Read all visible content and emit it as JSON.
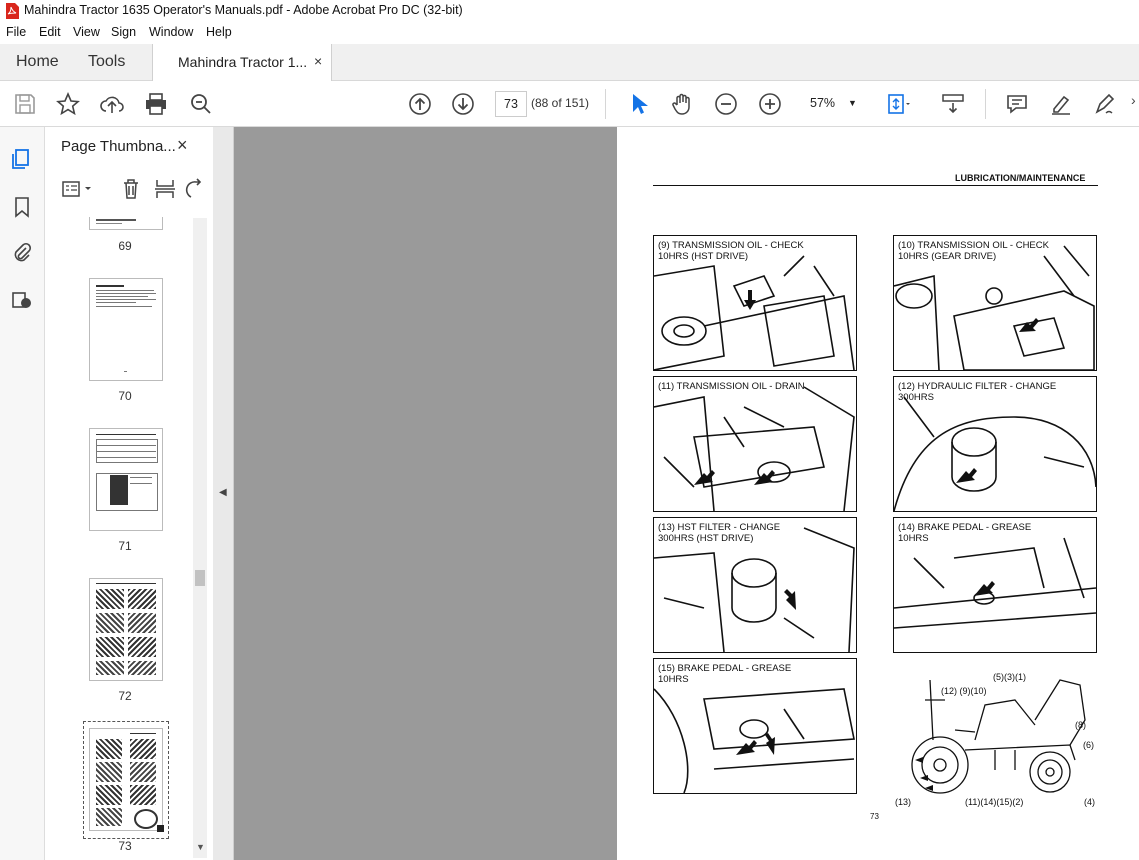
{
  "window": {
    "title": "Mahindra Tractor 1635 Operator's Manuals.pdf - Adobe Acrobat Pro DC (32-bit)"
  },
  "menu": [
    "File",
    "Edit",
    "View",
    "Sign",
    "Window",
    "Help"
  ],
  "tabs": {
    "home": "Home",
    "tools": "Tools",
    "doc": "Mahindra Tractor 1...",
    "close": "×"
  },
  "toolbar": {
    "page_current": "73",
    "page_count": "(88 of 151)",
    "zoom": "57%"
  },
  "panel": {
    "title": "Page Thumbna...",
    "close": "×"
  },
  "thumbnails": [
    {
      "label": "69"
    },
    {
      "label": "70"
    },
    {
      "label": "71"
    },
    {
      "label": "72"
    },
    {
      "label": "73"
    }
  ],
  "document": {
    "section_heading": "LUBRICATION/MAINTENANCE",
    "page_number": "73",
    "photos": [
      {
        "caption": "(9) TRANSMISSION OIL - CHECK\n10HRS (HST DRIVE)"
      },
      {
        "caption": "(10) TRANSMISSION OIL - CHECK\n10HRS (GEAR DRIVE)"
      },
      {
        "caption": "(11) TRANSMISSION OIL - DRAIN"
      },
      {
        "caption": "(12) HYDRAULIC FILTER - CHANGE\n300HRS"
      },
      {
        "caption": "(13) HST FILTER - CHANGE\n300HRS (HST DRIVE)"
      },
      {
        "caption": "(14) BRAKE PEDAL - GREASE\n10HRS"
      },
      {
        "caption": "(15) BRAKE PEDAL - GREASE\n10HRS"
      }
    ],
    "diagram_labels": {
      "top": "(5)(3)(1)",
      "top_left": "(12) (9)(10)",
      "right1": "(8)",
      "right2": "(6)",
      "bottom_left": "(13)",
      "bottom_mid": "(11)(14)(15)(2)",
      "bottom_right": "(4)"
    }
  },
  "colors": {
    "accent": "#1473e6",
    "acrobat_red": "#d9261c",
    "doc_bg": "#9a9a9a"
  }
}
